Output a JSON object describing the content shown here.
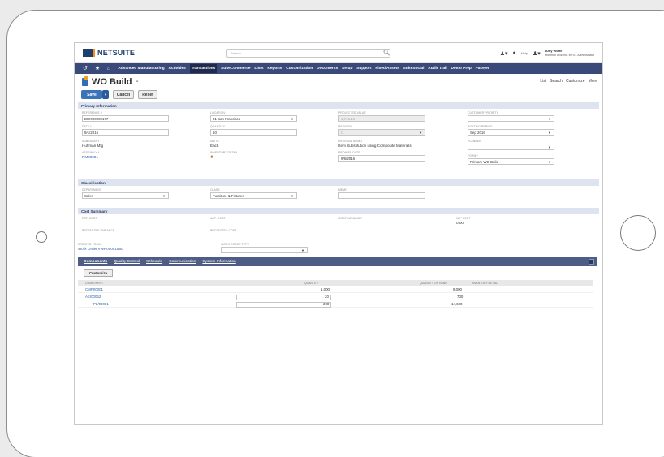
{
  "header": {
    "logo": "NETSUITE",
    "search_placeholder": "Search",
    "help_label": "Help",
    "user_name": "Amy Wolfe",
    "user_role": "Huffman CBE Inc. MFG - Administrator"
  },
  "nav": {
    "items": [
      "Advanced Manufacturing",
      "Activities",
      "Transactions",
      "SuiteCommerce",
      "Lists",
      "Reports",
      "Customization",
      "Documents",
      "Setup",
      "Support",
      "Fixed Assets",
      "SuiteSocial",
      "Audit Trail",
      "Demo Prep",
      "Pacejet"
    ],
    "active": "Transactions"
  },
  "page": {
    "title": "WO Build",
    "links": [
      "List",
      "Search",
      "Customize",
      "More"
    ],
    "save": "Save",
    "cancel": "Cancel",
    "reset": "Reset"
  },
  "sections": {
    "primary": "Primary Information",
    "classification": "Classification",
    "cost_summary": "Cost Summary"
  },
  "primary": {
    "reference_label": "Reference #",
    "reference_value": "BUI000000177",
    "date_label": "Date",
    "date_value": "9/1/2016",
    "subsidiary_label": "Subsidiary",
    "subsidiary_value": "Huffman Mfg",
    "assembly_label": "Assembly",
    "assembly_value": "RM00001",
    "location_label": "Location",
    "location_value": "01 San Francisco",
    "quantity_label": "Quantity",
    "quantity_value": "10",
    "units_label": "Units",
    "units_value": "Each",
    "inventory_label": "Inventory Detail",
    "projected_label": "Projected Value",
    "projected_value": "1,745.16",
    "revision_label": "Revision",
    "revision_value": "C",
    "revision_memo_label": "Revision Memo",
    "revision_memo_value": "Item Substitution using Composite Materials.",
    "promise_label": "Promise Date",
    "promise_value": "9/6/2016",
    "priority_label": "Customer Priority",
    "posting_label": "Posting Period",
    "posting_value": "Sep 2016",
    "planner_label": "Planner",
    "form_label": "Form",
    "form_value": "Primary WO Build"
  },
  "classification": {
    "department_label": "Department",
    "department_value": "Sales",
    "class_label": "Class",
    "class_value": "Furniture & Fixtures",
    "memo_label": "Memo"
  },
  "cost": {
    "est_label": "Est. Cost",
    "act_label": "Act. Cost",
    "variance_label": "Cost Variance",
    "wip_label": "WIP Cost",
    "wip_value": "0.00",
    "proj_var_label": "Projected Variance",
    "proj_cost_label": "Projected Cost",
    "created_label": "Created From",
    "created_value": "Work Order #WR00001560",
    "wo_type_label": "Work Order Type"
  },
  "sublist": {
    "tabs": [
      "Components",
      "Quality Control",
      "Schedule",
      "Communication",
      "System Information"
    ],
    "customize": "Customize",
    "columns": [
      "Component",
      "Quantity",
      "Quantity On Hand",
      "Inventory Detail"
    ],
    "rows": [
      {
        "component": "CMP00001",
        "quantity": "1,000",
        "on_hand": "9,000"
      },
      {
        "component": "AEI00052",
        "quantity": "20",
        "on_hand": "700"
      },
      {
        "component": "PL/00001",
        "quantity": "200",
        "on_hand": "14,600"
      }
    ]
  }
}
